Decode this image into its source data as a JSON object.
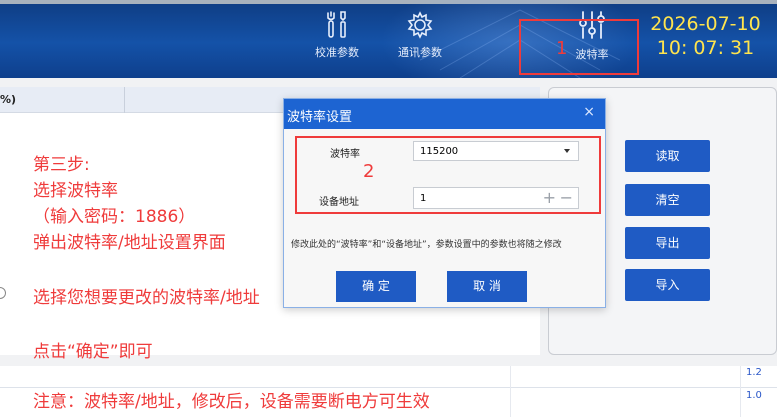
{
  "topbar": {
    "tools": [
      {
        "label": "校准参数",
        "icon": "tools-icon"
      },
      {
        "label": "通讯参数",
        "icon": "gear-icon"
      },
      {
        "label": "波特率",
        "icon": "sliders-icon"
      }
    ],
    "marker": "1",
    "date": "2026-07-10",
    "time": "10: 07: 31"
  },
  "table": {
    "header_fragment": "%)"
  },
  "instructions": {
    "step": "第三步:",
    "line1": "选择波特率",
    "line2": "（输入密码：1886）",
    "line3": "弹出波特率/地址设置界面",
    "line4": "选择您想要更改的波特率/地址",
    "line5": "点击“确定”即可",
    "note": "注意：波特率/地址，修改后，设备需要断电方可生效"
  },
  "side_buttons": [
    "读取",
    "清空",
    "导出",
    "导入"
  ],
  "dialog": {
    "title": "波特率设置",
    "close": "×",
    "baud_label": "波特率",
    "baud_value": "115200",
    "addr_label": "设备地址",
    "addr_value": "1",
    "plus": "+",
    "minus": "−",
    "marker": "2",
    "note": "修改此处的“波特率”和“设备地址”，参数设置中的参数也将随之修改",
    "ok": "确 定",
    "cancel": "取 消"
  },
  "versions": [
    "1.2",
    "1.0"
  ],
  "colors": {
    "header_blue": "#1452a8",
    "button_blue": "#1f5bc4",
    "annotation_red": "#ef3b3b",
    "clock_yellow": "#ffe44d"
  }
}
